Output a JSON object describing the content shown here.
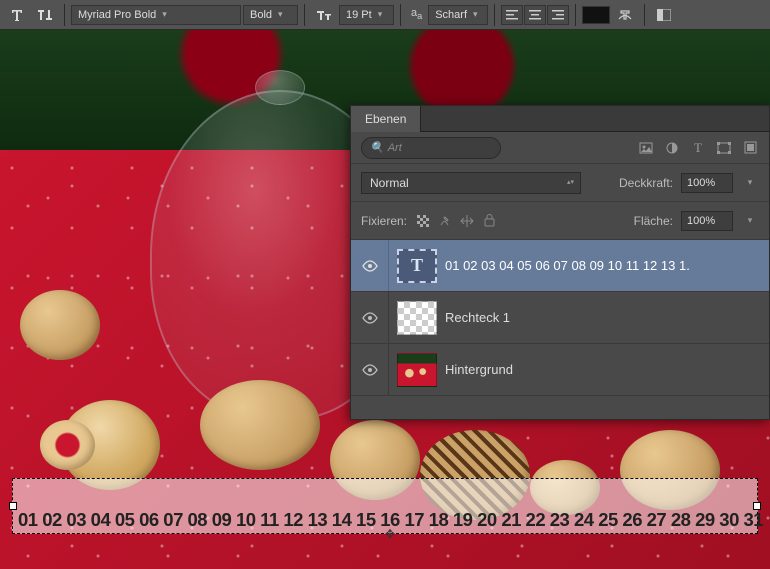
{
  "toolbar": {
    "font_family": "Myriad Pro Bold",
    "font_weight": "Bold",
    "font_size": "19 Pt",
    "aa_label": "a_a",
    "aa_mode": "Scharf"
  },
  "canvas": {
    "calendar_text": "01 02 03 04 05 06 07 08 09 10 11 12 13 14 15 16 17 18 19 20 21 22 23 24 25 26 27 28 29 30 31"
  },
  "panel": {
    "tab": "Ebenen",
    "search_placeholder": "Art",
    "blend_mode": "Normal",
    "opacity_label": "Deckkraft:",
    "opacity_value": "100%",
    "lock_label": "Fixieren:",
    "fill_label": "Fläche:",
    "fill_value": "100%",
    "layers": [
      {
        "name": "01 02 03 04 05 06 07 08 09 10 11 12 13 1.",
        "type": "text",
        "selected": true
      },
      {
        "name": "Rechteck 1",
        "type": "shape",
        "selected": false
      },
      {
        "name": "Hintergrund",
        "type": "image",
        "selected": false
      }
    ]
  }
}
